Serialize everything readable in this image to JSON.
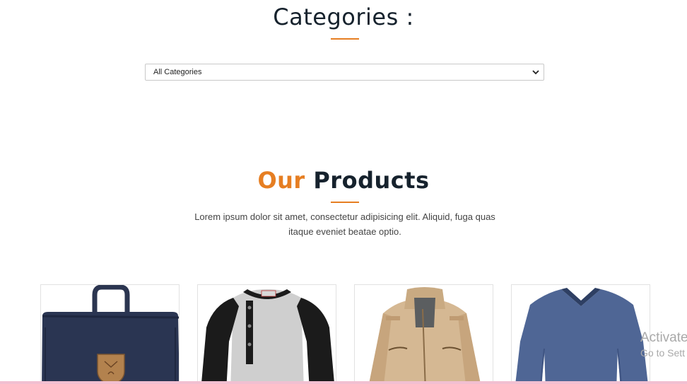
{
  "categories": {
    "title": "Categories :",
    "select": {
      "value": "All Categories"
    }
  },
  "products": {
    "title_accent": "Our",
    "title_rest": "Products",
    "description": "Lorem ipsum dolor sit amet, consectetur adipisicing elit. Aliquid, fuga quas itaque eveniet beatae optio.",
    "items": [
      {
        "image": "navy-backpack"
      },
      {
        "image": "raglan-henley-shirt"
      },
      {
        "image": "khaki-jacket"
      },
      {
        "image": "blue-vneck-sweater"
      }
    ]
  },
  "watermark": {
    "line1": "Activate",
    "line2": "Go to Sett"
  },
  "colors": {
    "accent": "#e67e22",
    "heading": "#16222d",
    "bottom_bar": "#f2bfd1"
  }
}
